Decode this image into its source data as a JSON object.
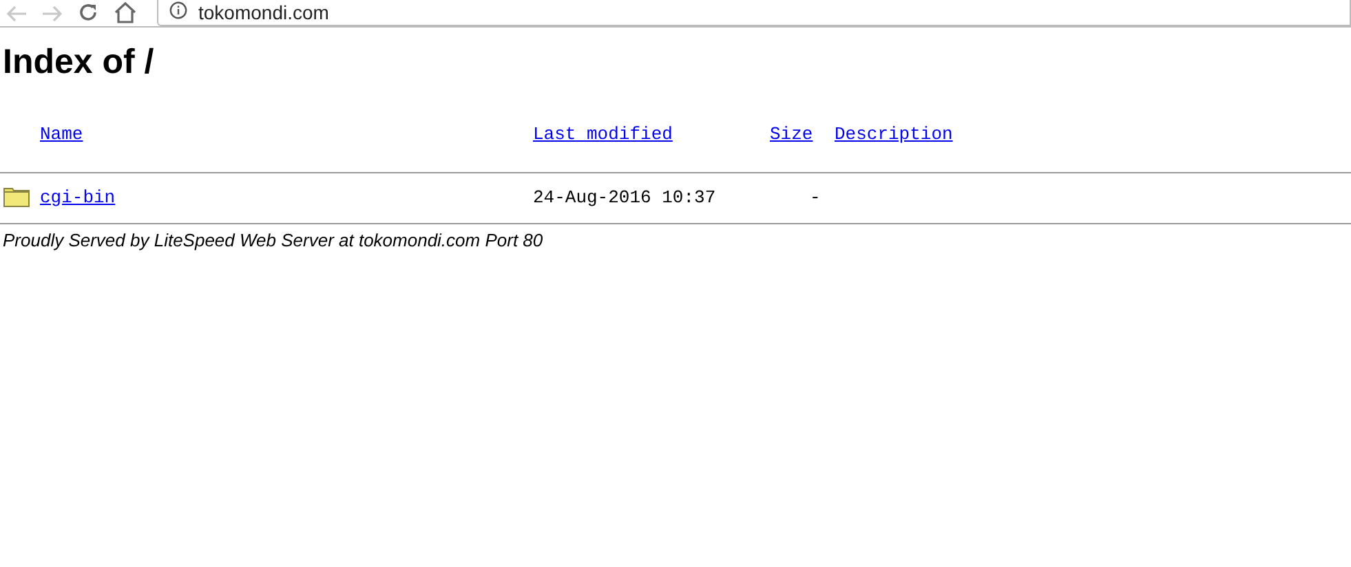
{
  "address_bar": {
    "url": "tokomondi.com"
  },
  "page": {
    "title": "Index of /",
    "columns": [
      "Name",
      "Last modified",
      "Size",
      "Description "
    ],
    "rows": [
      {
        "kind": "folder",
        "name": "cgi-bin",
        "modified": "24-Aug-2016 10:37",
        "size": "-"
      }
    ],
    "footer": "Proudly Served by LiteSpeed Web Server at tokomondi.com Port 80"
  }
}
